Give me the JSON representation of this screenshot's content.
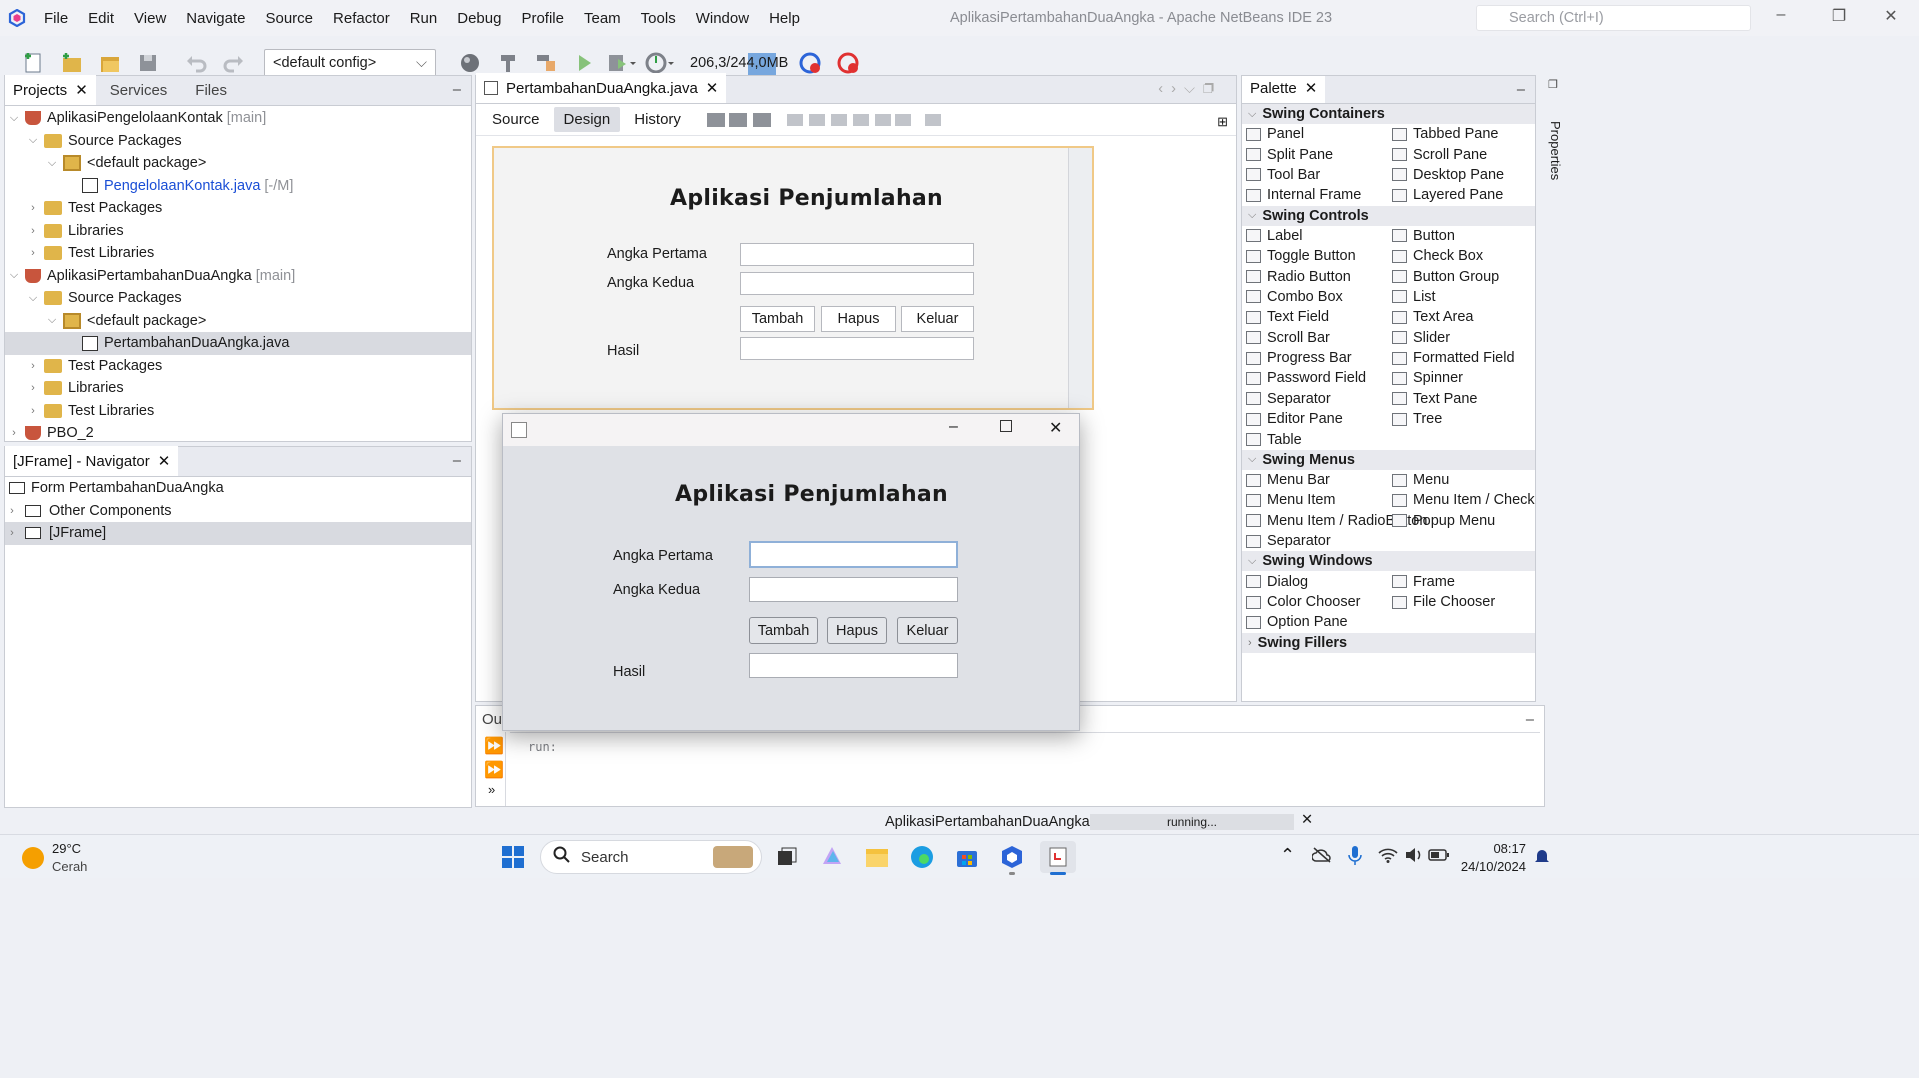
{
  "menubar": {
    "items": [
      "File",
      "Edit",
      "View",
      "Navigate",
      "Source",
      "Refactor",
      "Run",
      "Debug",
      "Profile",
      "Team",
      "Tools",
      "Window",
      "Help"
    ],
    "title": "AplikasiPertambahanDuaAngka - Apache NetBeans IDE 23",
    "search_placeholder": "Search (Ctrl+I)"
  },
  "toolbar": {
    "config": "<default config>",
    "memory": "206,3/244,0MB"
  },
  "projects": {
    "tabs": [
      "Projects",
      "Services",
      "Files"
    ],
    "rows": [
      {
        "label": "AplikasiPengelolaanKontak",
        "suffix": "[main]"
      },
      {
        "label": "Source Packages"
      },
      {
        "label": "<default package>"
      },
      {
        "label": "PengelolaanKontak.java",
        "suffix": "[-/M]"
      },
      {
        "label": "Test Packages"
      },
      {
        "label": "Libraries"
      },
      {
        "label": "Test Libraries"
      },
      {
        "label": "AplikasiPertambahanDuaAngka",
        "suffix": "[main]"
      },
      {
        "label": "Source Packages"
      },
      {
        "label": "<default package>"
      },
      {
        "label": "PertambahanDuaAngka.java"
      },
      {
        "label": "Test Packages"
      },
      {
        "label": "Libraries"
      },
      {
        "label": "Test Libraries"
      },
      {
        "label": "PBO_2"
      }
    ]
  },
  "navigator": {
    "title": "[JFrame] - Navigator",
    "rows": [
      "Form PertambahanDuaAngka",
      "Other Components",
      "[JFrame]"
    ]
  },
  "editor": {
    "tab": "PertambahanDuaAngka.java",
    "subtabs": [
      "Source",
      "Design",
      "History"
    ]
  },
  "form": {
    "title": "Aplikasi Penjumlahan",
    "label1": "Angka Pertama",
    "label2": "Angka Kedua",
    "label3": "Hasil",
    "btn_add": "Tambah",
    "btn_clear": "Hapus",
    "btn_exit": "Keluar"
  },
  "palette": {
    "title": "Palette",
    "categories": [
      {
        "name": "Swing Containers",
        "items": [
          "Panel",
          "Tabbed Pane",
          "Split Pane",
          "Scroll Pane",
          "Tool Bar",
          "Desktop Pane",
          "Internal Frame",
          "Layered Pane"
        ]
      },
      {
        "name": "Swing Controls",
        "items": [
          "Label",
          "Button",
          "Toggle Button",
          "Check Box",
          "Radio Button",
          "Button Group",
          "Combo Box",
          "List",
          "Text Field",
          "Text Area",
          "Scroll Bar",
          "Slider",
          "Progress Bar",
          "Formatted Field",
          "Password Field",
          "Spinner",
          "Separator",
          "Text Pane",
          "Editor Pane",
          "Tree",
          "Table"
        ]
      },
      {
        "name": "Swing Menus",
        "items": [
          "Menu Bar",
          "Menu",
          "Menu Item",
          "Menu Item / CheckBox",
          "Menu Item / RadioButton",
          "Popup Menu",
          "Separator"
        ]
      },
      {
        "name": "Swing Windows",
        "items": [
          "Dialog",
          "Frame",
          "Color Chooser",
          "File Chooser",
          "Option Pane"
        ]
      },
      {
        "name": "Swing Fillers",
        "items": []
      }
    ]
  },
  "side": {
    "properties": "Properties"
  },
  "output": {
    "tab": "Out",
    "text": "run:"
  },
  "status": {
    "task": "AplikasiPertambahanDuaAngka (run)",
    "progress_text": "running..."
  },
  "taskbar": {
    "temp": "29°C",
    "weather": "Cerah",
    "search": "Search",
    "time": "08:17",
    "date": "24/10/2024"
  },
  "colors": {
    "accent": "#1a4ed6",
    "selection": "#d8dae0",
    "form_border": "#f0c987"
  }
}
